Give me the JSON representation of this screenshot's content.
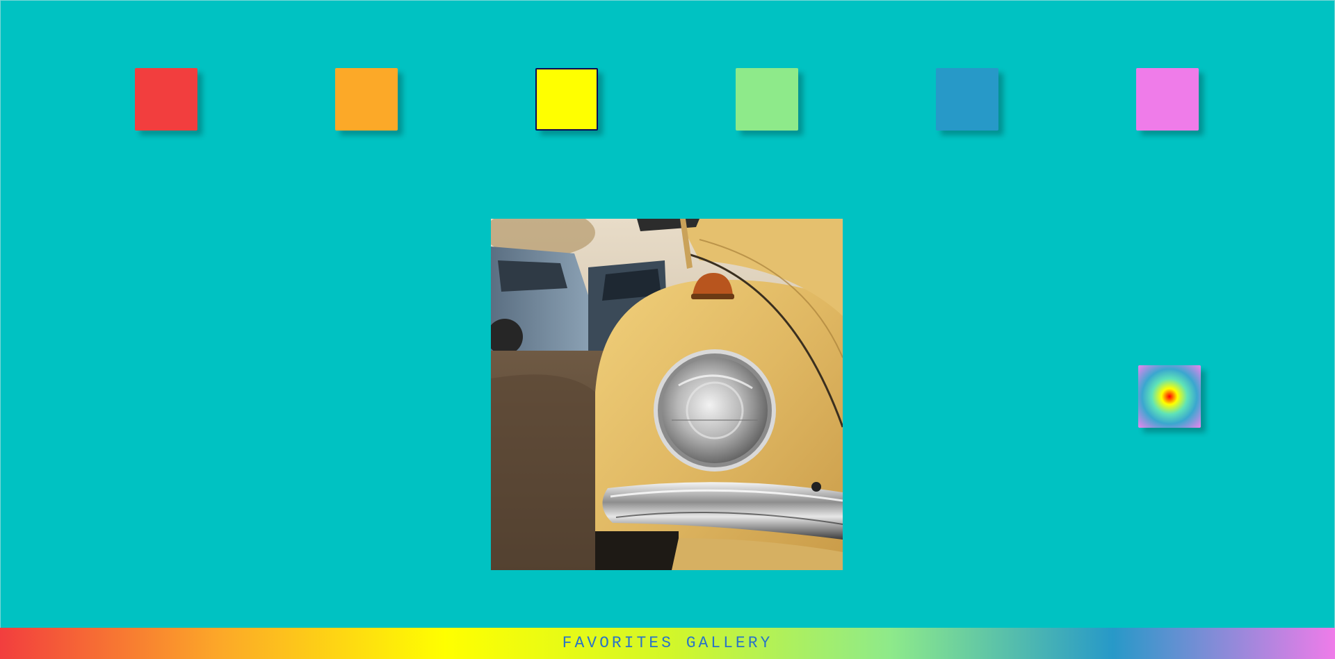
{
  "palette": {
    "background": "#00c2c2",
    "selected_border": "#0b0b55",
    "swatches": [
      {
        "name": "red",
        "color": "#f23e3e",
        "selected": false
      },
      {
        "name": "orange",
        "color": "#fca928",
        "selected": false
      },
      {
        "name": "yellow",
        "color": "#ffff00",
        "selected": true
      },
      {
        "name": "light-green",
        "color": "#8eea8a",
        "selected": false
      },
      {
        "name": "blue",
        "color": "#2799c8",
        "selected": false
      },
      {
        "name": "pink",
        "color": "#ef7ce9",
        "selected": false
      }
    ]
  },
  "gallery": {
    "photo_subject": "vintage yellow car headlight close-up"
  },
  "random_tile": {
    "gradient_colors": [
      "#ff0000",
      "#ffff00",
      "#5fe3b8",
      "#3aa7cf",
      "#ee84ee"
    ]
  },
  "footer": {
    "title": "FAVORITES GALLERY",
    "gradient_colors": [
      "#f23e3e",
      "#fca928",
      "#ffff00",
      "#d3f728",
      "#8eea8a",
      "#2799c8",
      "#ef7ce9"
    ]
  }
}
